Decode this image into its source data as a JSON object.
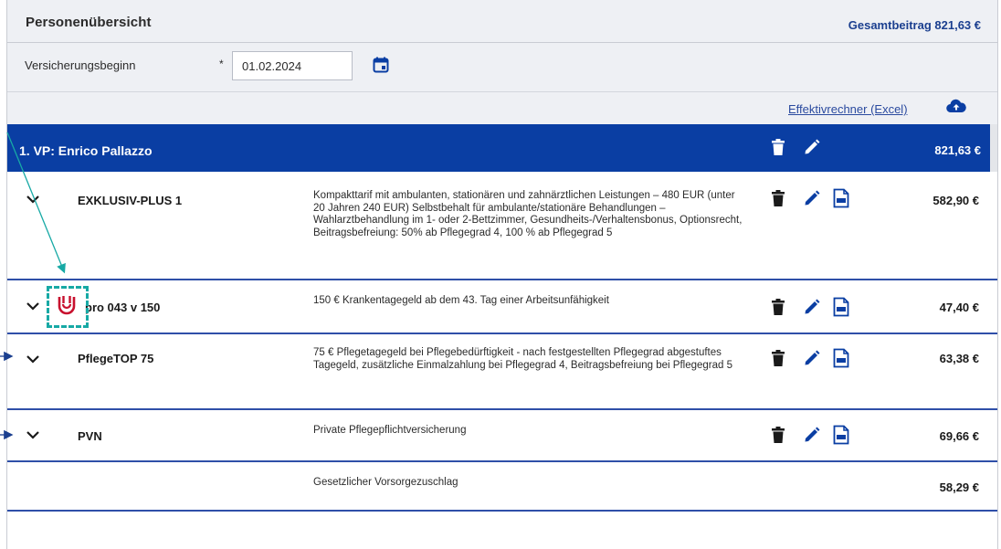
{
  "header": {
    "title": "Personenübersicht",
    "total": "Gesamtbeitrag 821,63 €"
  },
  "versicherungsbeginn": {
    "label": "Versicherungsbeginn",
    "required_marker": "*",
    "value": "01.02.2024"
  },
  "excel_link": "Effektivrechner (Excel)",
  "person": {
    "name": "1. VP: Enrico Pallazzo",
    "amount": "821,63 €"
  },
  "tariffs": [
    {
      "name": "EXKLUSIV-PLUS 1",
      "description": "Kompakttarif mit ambulanten, stationären und zahnärztlichen Leistungen – 480 EUR (unter 20 Jahren 240 EUR) Selbstbehalt für ambulante/stationäre Behandlungen – Wahlarztbehandlung im 1- oder 2-Bettzimmer, Gesundheits-/Verhaltensbonus, Optionsrecht, Beitragsbefreiung: 50% ab Pflegegrad 4, 100 % ab Pflegegrad 5",
      "amount": "582,90 €"
    },
    {
      "name": "pro 043 v 150",
      "description": "150 € Krankentagegeld ab dem 43. Tag einer Arbeitsunfähigkeit",
      "amount": "47,40 €"
    },
    {
      "name": "PflegeTOP 75",
      "description": "75 € Pflegetagegeld bei Pflegebedürftigkeit - nach festgestellten Pflegegrad abgestuftes Tagegeld, zusätzliche Einmalzahlung bei Pflegegrad 4, Beitragsbefreiung bei Pflegegrad 5",
      "amount": "63,38 €"
    },
    {
      "name": "PVN",
      "description": "Private Pflegepflichtversicherung",
      "amount": "69,66 €"
    }
  ],
  "surcharge": {
    "description": "Gesetzlicher Vorsorgezuschlag",
    "amount": "58,29 €"
  },
  "colors": {
    "primary_blue": "#0a3ea3",
    "annotation_teal": "#17a9a5",
    "badge_red": "#c8102e"
  },
  "icons": [
    "calendar-icon",
    "cloud-upload-icon",
    "trash-icon",
    "pencil-icon",
    "pdf-icon",
    "chevron-down-icon",
    "badge-icon"
  ]
}
